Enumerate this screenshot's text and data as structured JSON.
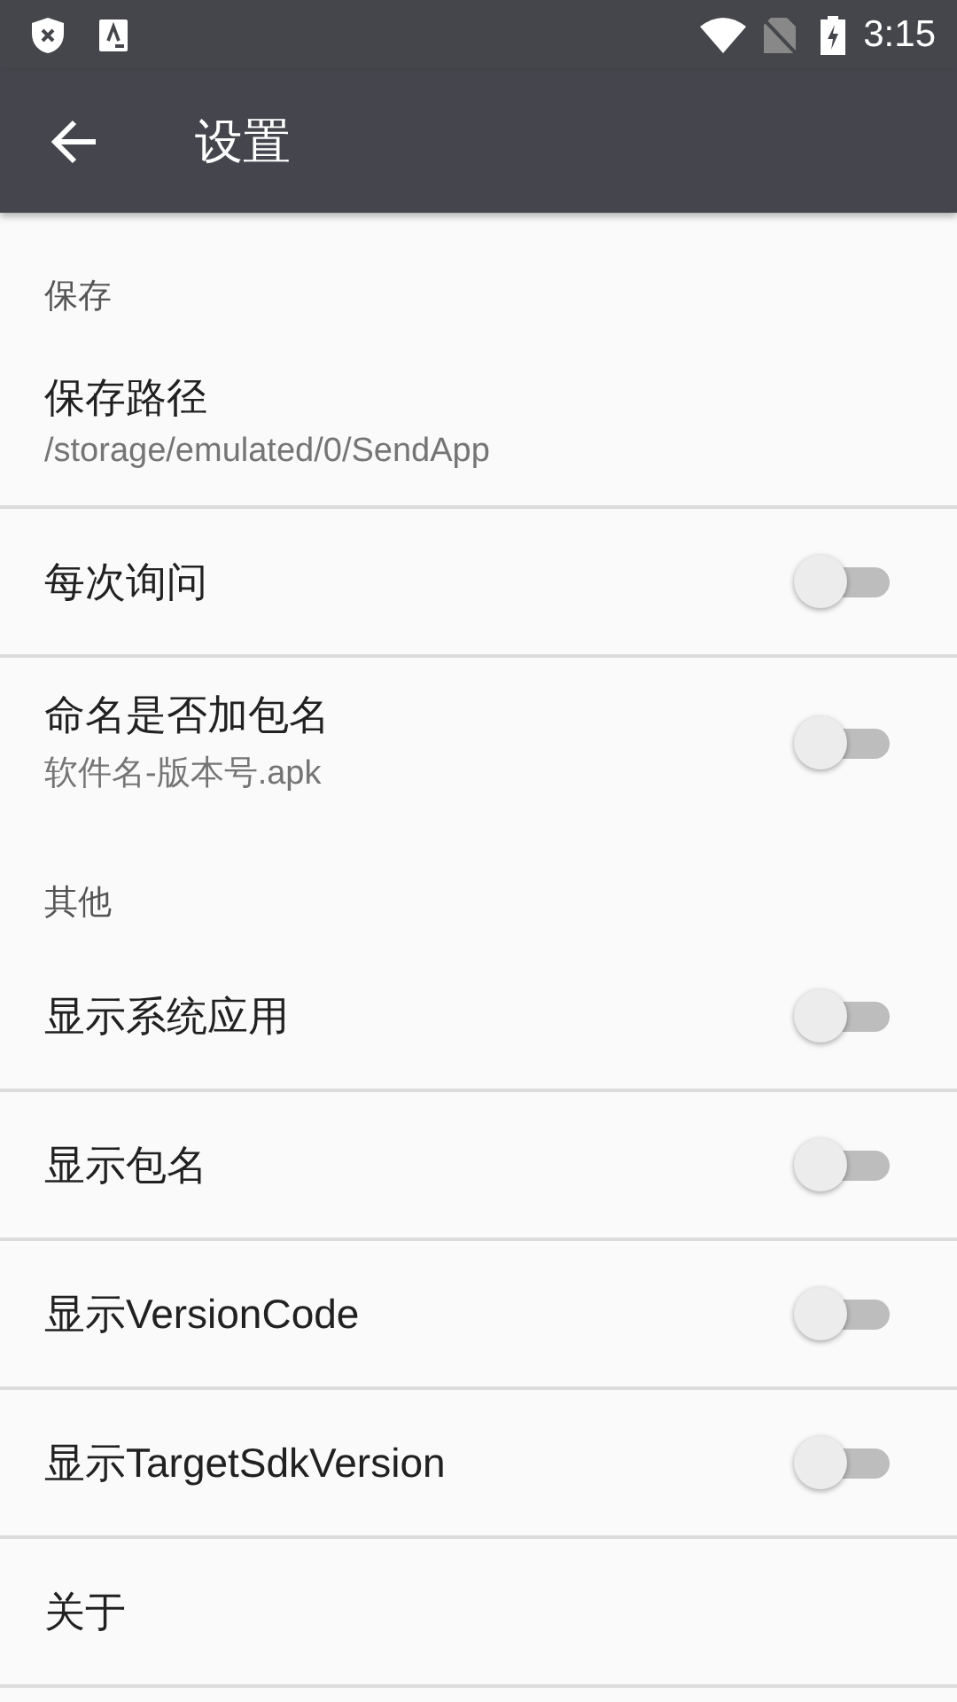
{
  "status_bar": {
    "time": "3:15"
  },
  "app_bar": {
    "title": "设置"
  },
  "sections": [
    {
      "title": "保存",
      "items": [
        {
          "kind": "text",
          "title": "保存路径",
          "summary": "/storage/emulated/0/SendApp"
        },
        {
          "kind": "switch",
          "title": "每次询问",
          "on": false
        },
        {
          "kind": "switch",
          "title": "命名是否加包名",
          "summary": "软件名-版本号.apk",
          "on": false
        }
      ]
    },
    {
      "title": "其他",
      "items": [
        {
          "kind": "switch",
          "title": "显示系统应用",
          "on": false
        },
        {
          "kind": "switch",
          "title": "显示包名",
          "on": false
        },
        {
          "kind": "switch",
          "title": "显示VersionCode",
          "on": false
        },
        {
          "kind": "switch",
          "title": "显示TargetSdkVersion",
          "on": false
        },
        {
          "kind": "text",
          "title": "关于"
        }
      ]
    }
  ]
}
